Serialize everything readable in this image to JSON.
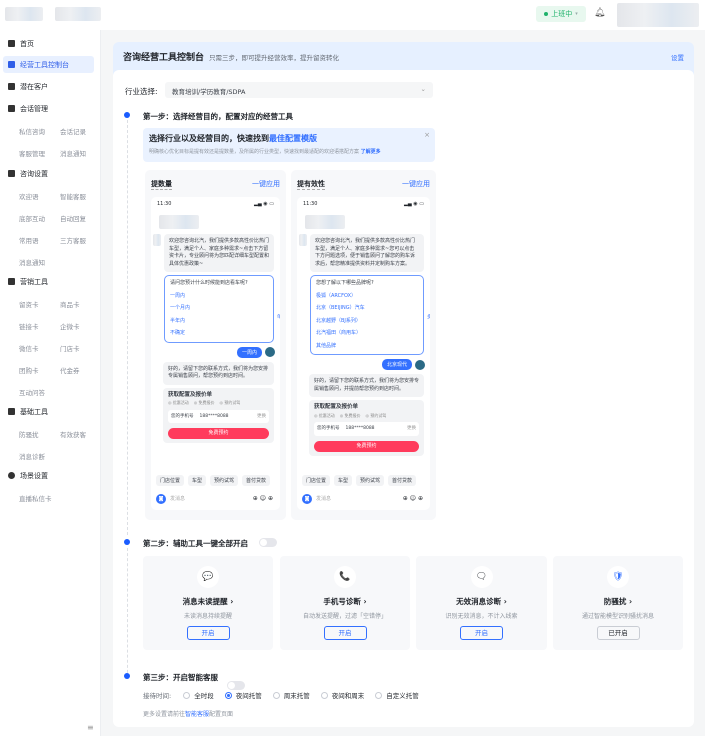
{
  "topbar": {
    "status": "上班中",
    "status_color": "#1fb26b"
  },
  "sidebar": {
    "items": [
      {
        "label": "首页"
      },
      {
        "label": "经营工具控制台",
        "active": true
      },
      {
        "label": "潜在客户"
      },
      {
        "label": "会话管理"
      },
      {
        "label": "咨询设置"
      },
      {
        "label": "营销工具"
      },
      {
        "label": "基础工具"
      },
      {
        "label": "场景设置"
      }
    ],
    "sub": {
      "session": [
        "私信咨询",
        "会话记录",
        "客服管理",
        "消息通知"
      ],
      "consult": [
        "欢迎语",
        "智能客服",
        "底部互动",
        "自动回复",
        "常用语",
        "三方客服",
        "消息通知"
      ],
      "marketing": [
        "留资卡",
        "商品卡",
        "链接卡",
        "企微卡",
        "微信卡",
        "门店卡",
        "团购卡",
        "代金券",
        "互动问答"
      ],
      "basic": [
        "防骚扰",
        "有效获客",
        "消息诊断"
      ],
      "scene": [
        "直播私信卡"
      ]
    }
  },
  "header": {
    "title": "咨询经营工具控制台",
    "subtitle": "只需三步，即可提升经营效率，提升留资转化",
    "settings": "设置"
  },
  "industry": {
    "label": "行业选择:",
    "value": "教育培训/学历教育/SDPA"
  },
  "step1": {
    "title": "第一步：选择经营目的，配置对应的经营工具",
    "banner": {
      "title": "选择行业以及经营目的，快速找到",
      "highlight": "最佳配置模版",
      "desc": "明确核心优化目标是提有效还是提数量，及所属的行业类型，快速找到最适配的欢迎语搭配方案",
      "link": "了解更多"
    },
    "panels": [
      {
        "title": "提数量",
        "apply": "一键应用",
        "time": "11:30",
        "welcome": "欢迎您咨询北汽，我们提供多款高性价比热门车型，满足个人、家庭多种需求~点击下方留资卡片，专业顾问将为您匹配详细车型配置和具体优惠政策~",
        "question": "请问您预计什么时候能到店看车呢?",
        "options": [
          "一周内",
          "一个月内",
          "半年内",
          "不确定"
        ],
        "annotation": "单轮问答",
        "reply": "一周内",
        "followup": "好的，请留下您的联系方式，我们将为您安排专属销售顾问，帮您预约到店时间。",
        "form_title": "获取配置及报价单",
        "checks": [
          "优惠活动",
          "免费报价",
          "预约试驾"
        ],
        "phone_label": "您的手机号",
        "phone": "188****8088",
        "change": "更换",
        "submit": "免费预约",
        "chips": [
          "门店位置",
          "车型",
          "预约试驾",
          "首付贷款"
        ],
        "input": "发消息"
      },
      {
        "title": "提有效性",
        "apply": "一键应用",
        "time": "11:30",
        "welcome": "欢迎您咨询北汽，我们提供多款高性价比热门车型，满足个人、家庭多种需求~您可以点击下方问题选项，便于销售顾问了解您的购车诉求后，帮您精准提供资料并定制购车方案。",
        "question": "您想了解以下哪些品牌呢?",
        "options": [
          "极狐（ARCFOX）",
          "北京（BEIJING）汽车",
          "北京越野（BJ系列）",
          "北汽福田（商用车）",
          "其他品牌"
        ],
        "annotation": "多轮问答",
        "reply": "北京现代",
        "followup": "好的，请留下您的联系方式，我们将为您安排专属销售顾问，并提前帮您预约到店时间。",
        "form_title": "获取配置及报价单",
        "checks": [
          "优惠活动",
          "免费报价",
          "预约试驾"
        ],
        "phone_label": "您的手机号",
        "phone": "188****8088",
        "change": "更换",
        "submit": "免费预约",
        "chips": [
          "门店位置",
          "车型",
          "预约试驾",
          "首付贷款"
        ],
        "input": "发消息"
      }
    ]
  },
  "step2": {
    "title": "第二步：辅助工具一键全部开启",
    "tools": [
      {
        "name": "消息未读提醒",
        "desc": "未读消息持续提醒",
        "button": "开启",
        "icon": "💬"
      },
      {
        "name": "手机号诊断",
        "desc": "自动发送提醒，过滤「空错停」",
        "button": "开启",
        "icon": "📞"
      },
      {
        "name": "无效消息诊断",
        "desc": "识别无效消息，不计入线索",
        "button": "开启",
        "icon": "🗨"
      },
      {
        "name": "防骚扰",
        "desc": "通过智能模型识别骚扰消息",
        "button": "已开启",
        "icon": "🛡"
      }
    ]
  },
  "step3": {
    "title": "第三步：开启智能客服",
    "time_label": "接待时间:",
    "options": [
      "全时段",
      "夜间托管",
      "周末托管",
      "夜间和周末",
      "自定义托管"
    ],
    "selected": "夜间托管",
    "note_prefix": "更多设置请前往",
    "note_link": "智能客服",
    "note_suffix": "配置页面"
  },
  "colors": {
    "accent": "#3370ff",
    "danger": "#ff3b5c"
  }
}
